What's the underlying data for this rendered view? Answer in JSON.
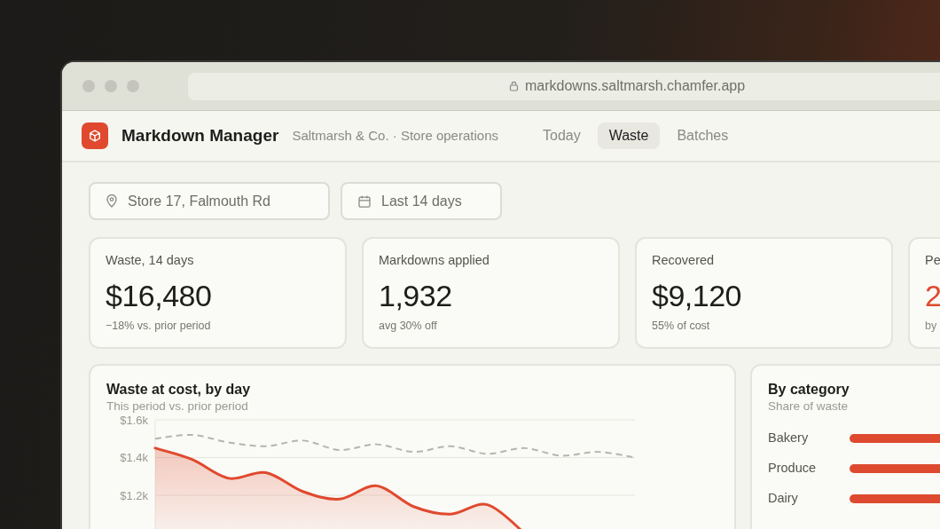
{
  "browser": {
    "url": "markdowns.saltmarsh.chamfer.app"
  },
  "app": {
    "title": "Markdown Manager",
    "subtitle": "Saltmarsh & Co. · Store operations"
  },
  "tabs": [
    {
      "label": "Today",
      "selected": false
    },
    {
      "label": "Waste",
      "selected": true
    },
    {
      "label": "Batches",
      "selected": false
    }
  ],
  "filters": [
    {
      "kind": "location",
      "value": "Store 17, Falmouth Rd"
    },
    {
      "kind": "date",
      "value": "Last 14 days"
    }
  ],
  "kpis": [
    {
      "label": "Waste, 14 days",
      "value": "$16,480",
      "note": "−18% vs. prior period",
      "alert": false
    },
    {
      "label": "Markdowns applied",
      "value": "1,932",
      "note": "avg 30% off",
      "alert": false
    },
    {
      "label": "Recovered",
      "value": "$9,120",
      "note": "55% of cost",
      "alert": false
    },
    {
      "label": "Pe",
      "value": "2",
      "note": "by",
      "alert": true
    }
  ],
  "waste_chart": {
    "title": "Waste at cost, by day",
    "subtitle": "This period vs. prior period",
    "chart_data": {
      "type": "area",
      "ylim": [
        1.0,
        1.6
      ],
      "yticks": [
        {
          "value": 1.6,
          "label": "$1.6k"
        },
        {
          "value": 1.4,
          "label": "$1.4k"
        },
        {
          "value": 1.2,
          "label": "$1.2k"
        }
      ],
      "series": [
        {
          "type": "area",
          "line_style": "solid",
          "color": "#e0492e",
          "values": [
            1.45,
            1.39,
            1.29,
            1.32,
            1.22,
            1.18,
            1.25,
            1.14,
            1.1,
            1.15,
            1.0,
            null,
            null,
            null
          ]
        },
        {
          "type": "line",
          "line_style": "dashed",
          "color": "#b5b5b0",
          "values": [
            1.5,
            1.52,
            1.48,
            1.46,
            1.49,
            1.44,
            1.47,
            1.43,
            1.46,
            1.42,
            1.45,
            1.41,
            1.43,
            1.4
          ]
        }
      ]
    }
  },
  "category_card": {
    "title": "By category",
    "subtitle": "Share of waste",
    "items": [
      {
        "label": "Bakery"
      },
      {
        "label": "Produce"
      },
      {
        "label": "Dairy"
      }
    ]
  }
}
